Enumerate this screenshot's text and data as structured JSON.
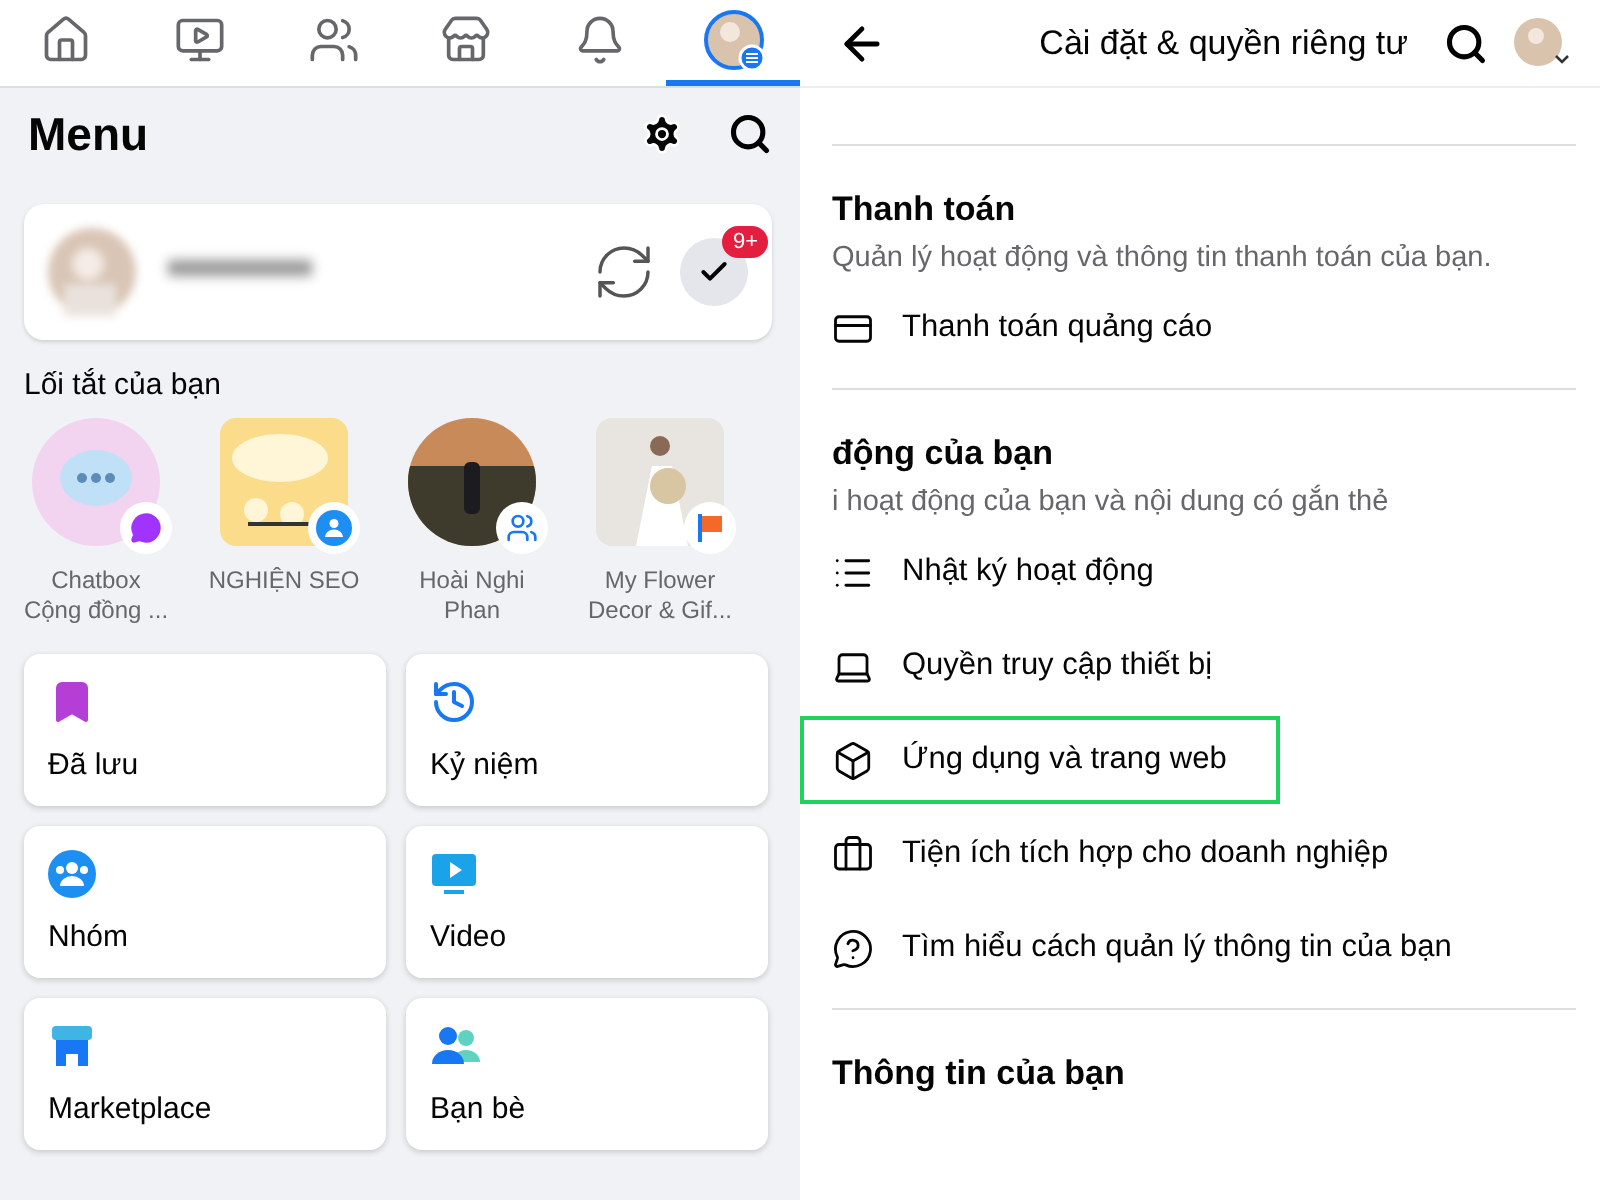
{
  "menu_panel": {
    "tabs": [
      {
        "selected": false
      },
      {
        "selected": false
      },
      {
        "selected": false
      },
      {
        "selected": false
      },
      {
        "selected": false
      },
      {
        "selected": true
      }
    ],
    "title": "Menu",
    "profile": {
      "badge": "9+"
    },
    "shortcuts_title": "Lối tắt của bạn",
    "shortcuts": [
      {
        "name": "Chatbox\nCộng đồng ..."
      },
      {
        "name": "NGHIỆN SEO"
      },
      {
        "name": "Hoài Nghi\nPhan"
      },
      {
        "name": "My Flower\nDecor & Gif..."
      }
    ],
    "tiles": [
      {
        "label": "Đã lưu"
      },
      {
        "label": "Kỷ niệm"
      },
      {
        "label": "Nhóm"
      },
      {
        "label": "Video"
      },
      {
        "label": "Marketplace"
      },
      {
        "label": "Bạn bè"
      }
    ]
  },
  "settings_panel": {
    "title": "Cài đặt & quyền riêng tư",
    "sections": [
      {
        "title": "Thanh toán",
        "subtitle": "Quản lý hoạt động và thông tin thanh toán của bạn.",
        "items": [
          {
            "label": "Thanh toán quảng cáo",
            "highlighted": false
          }
        ]
      },
      {
        "title": "động của bạn",
        "subtitle": "i hoạt động của bạn và nội dung có gắn thẻ",
        "items": [
          {
            "label": "Nhật ký hoạt động",
            "highlighted": false
          },
          {
            "label": "Quyền truy cập thiết bị",
            "highlighted": false
          },
          {
            "label": "Ứng dụng và trang web",
            "highlighted": true
          },
          {
            "label": "Tiện ích tích hợp cho doanh nghiệp",
            "highlighted": false
          },
          {
            "label": "Tìm hiểu cách quản lý thông tin của bạn",
            "highlighted": false
          }
        ]
      },
      {
        "title": "Thông tin của bạn"
      }
    ]
  }
}
